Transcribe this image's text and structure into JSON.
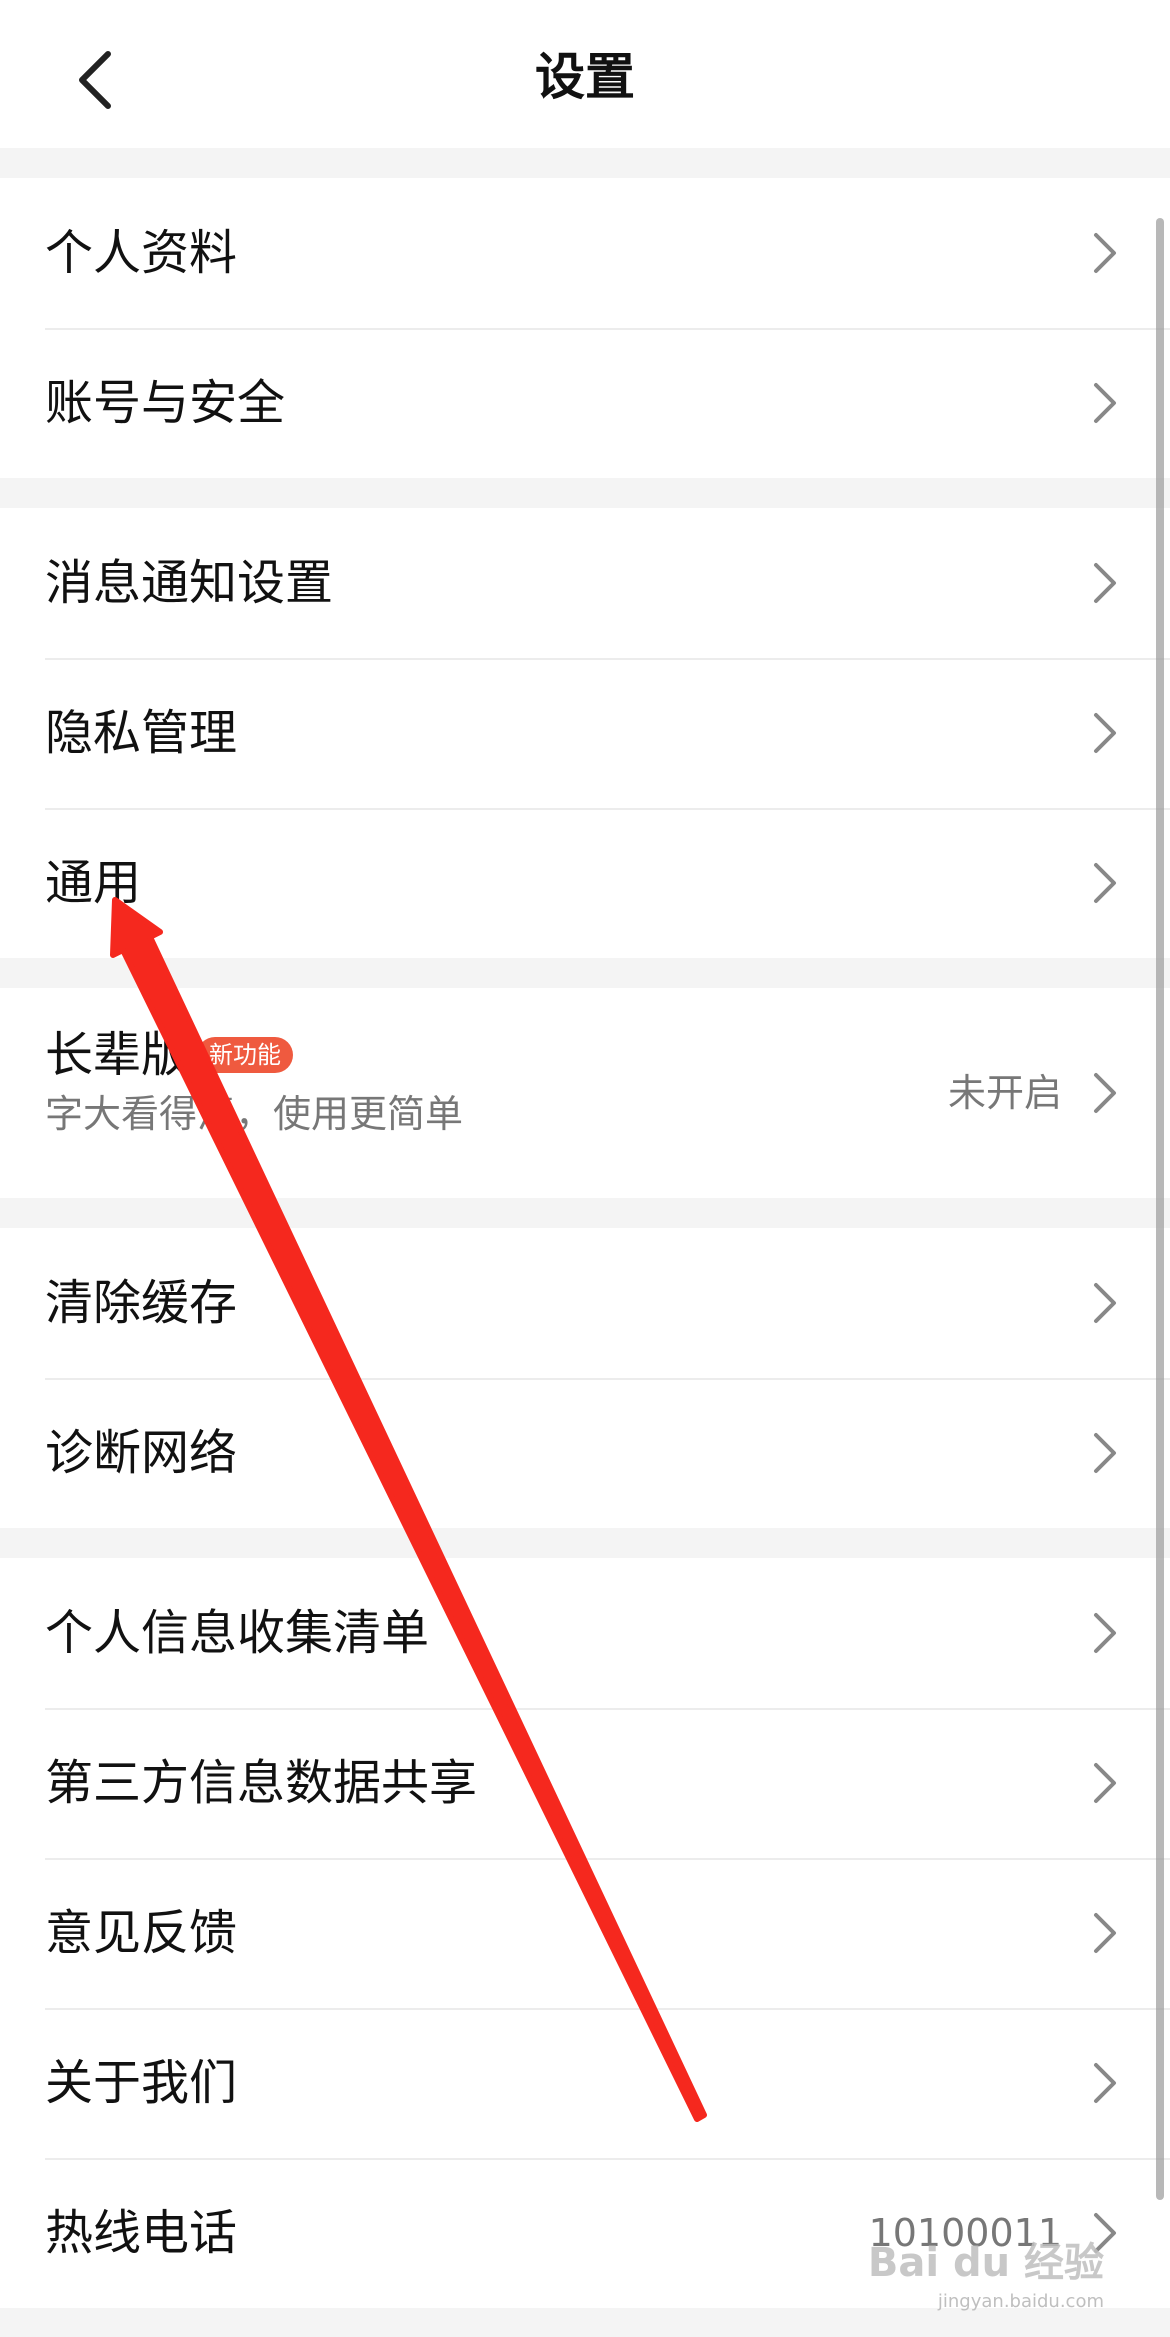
{
  "header": {
    "title": "设置",
    "back_icon": "chevron-left-icon"
  },
  "groups": [
    {
      "items": [
        {
          "label": "个人资料"
        },
        {
          "label": "账号与安全"
        }
      ]
    },
    {
      "items": [
        {
          "label": "消息通知设置"
        },
        {
          "label": "隐私管理"
        },
        {
          "label": "通用"
        }
      ]
    },
    {
      "items": [
        {
          "label": "长辈版",
          "badge": "新功能",
          "subtitle": "字大看得清，使用更简单",
          "value": "未开启"
        }
      ]
    },
    {
      "items": [
        {
          "label": "清除缓存"
        },
        {
          "label": "诊断网络"
        }
      ]
    },
    {
      "items": [
        {
          "label": "个人信息收集清单"
        },
        {
          "label": "第三方信息数据共享"
        },
        {
          "label": "意见反馈"
        },
        {
          "label": "关于我们"
        },
        {
          "label": "热线电话",
          "value": "10100011"
        }
      ]
    }
  ],
  "colors": {
    "badge": "#ef5a3f",
    "annotation_arrow": "#f5281e",
    "background": "#f4f4f4"
  },
  "watermark": {
    "text": "Bai du 经验",
    "url": "jingyan.baidu.com"
  }
}
